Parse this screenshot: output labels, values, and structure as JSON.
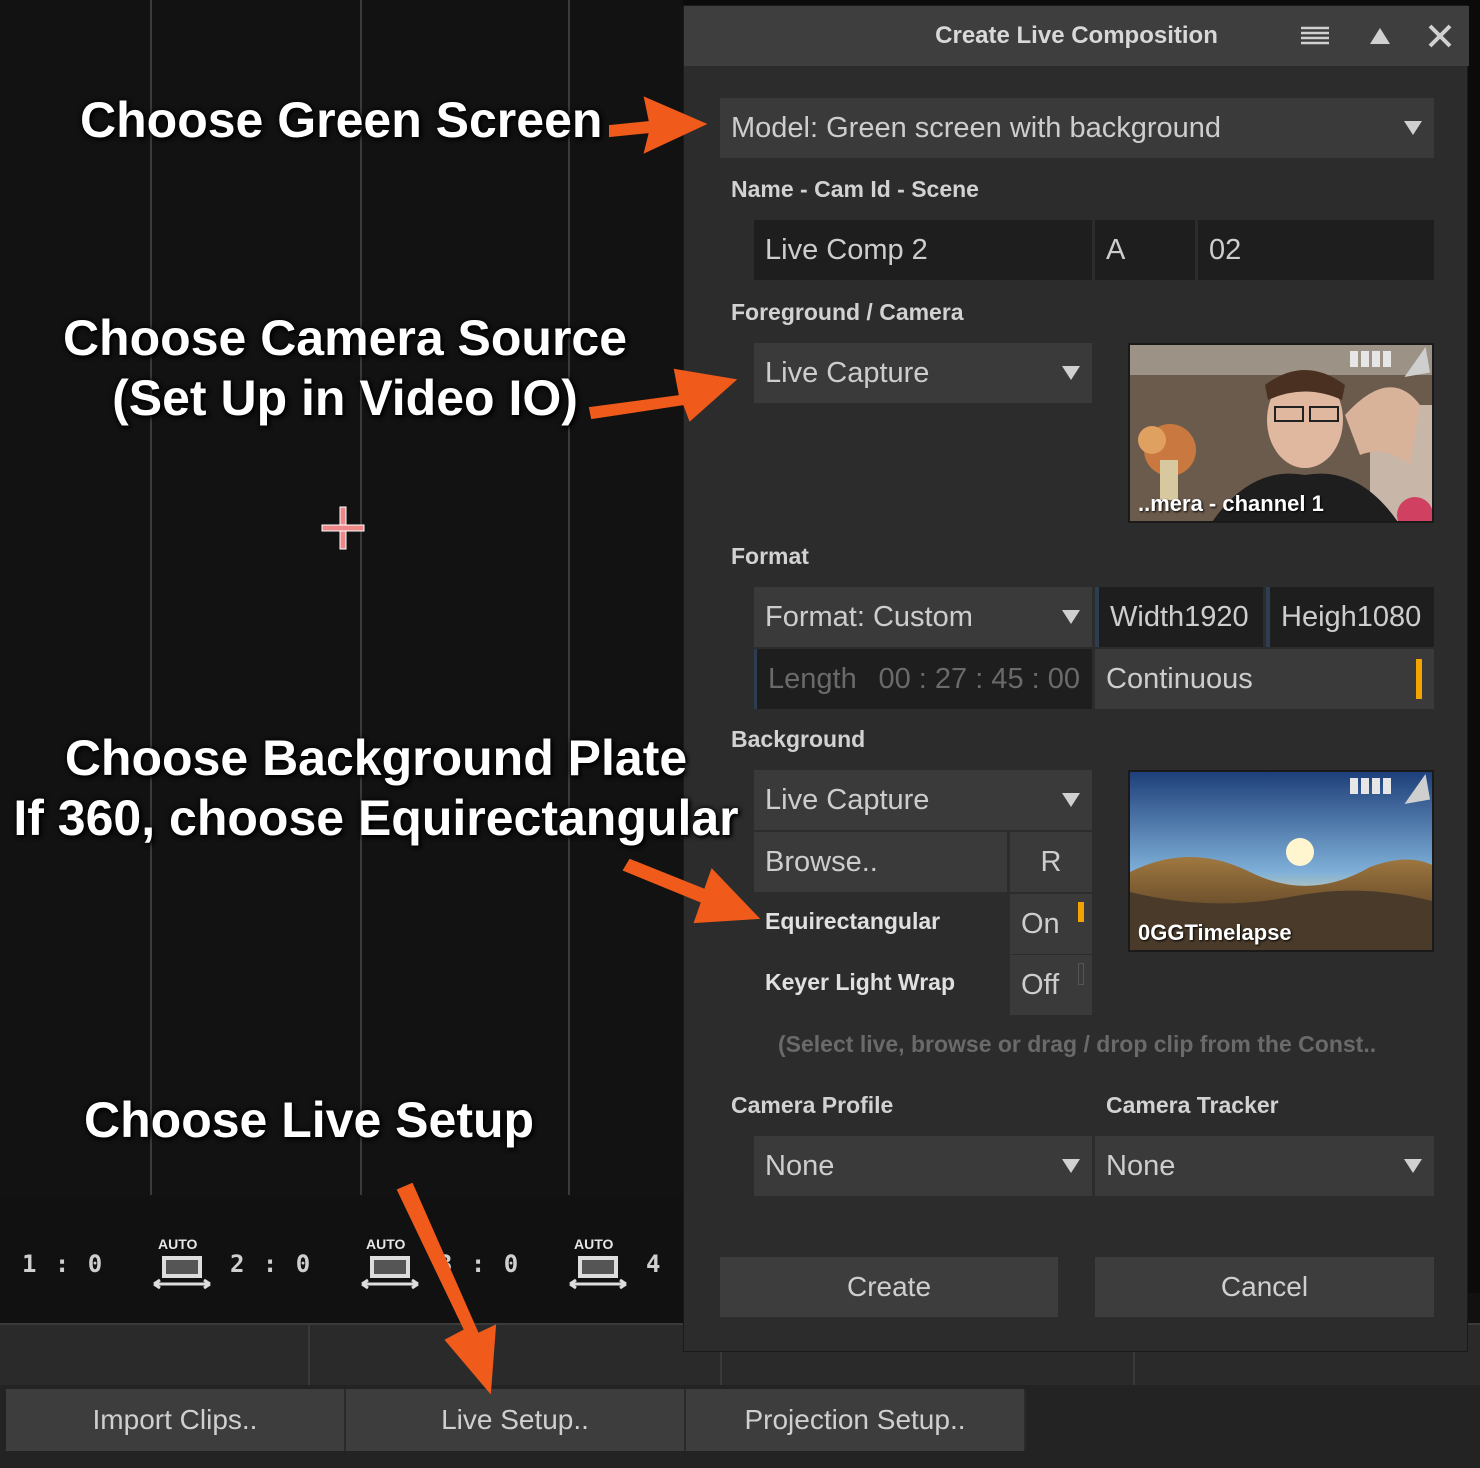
{
  "annotations": {
    "green_screen": "Choose Green Screen",
    "camera_line1": "Choose Camera Source",
    "camera_line2": "(Set Up in Video IO)",
    "background_line1": "Choose Background Plate",
    "background_line2": "If 360, choose Equirectangular",
    "live_setup": "Choose Live Setup",
    "arrow_color": "#f05a1a"
  },
  "timeline": {
    "markers": [
      "1 : 0",
      "2 : 0",
      "3 : 0",
      "4 :"
    ],
    "auto_label": "AUTO"
  },
  "bottom_buttons": {
    "import": "Import Clips..",
    "live_setup": "Live Setup..",
    "projection": "Projection Setup.."
  },
  "dialog": {
    "title": "Create Live Composition",
    "icons": [
      "menu-icon",
      "collapse-icon",
      "close-icon"
    ],
    "model": "Model: Green screen with background",
    "name_label": "Name - Cam Id - Scene",
    "name": "Live Comp 2",
    "cam_id": "A",
    "scene": "02",
    "foreground_label": "Foreground / Camera",
    "foreground_source": "Live Capture",
    "foreground_thumb_caption": "..mera - channel 1",
    "format_label": "Format",
    "format": "Format: Custom",
    "width_label": "Width",
    "width": "1920",
    "height_label": "Heigh",
    "height": "1080",
    "length_label": "Length",
    "length": "00 : 27 : 45 : 00",
    "continuous": "Continuous",
    "background_label": "Background",
    "background_source": "Live Capture",
    "browse": "Browse..",
    "r_button": "R",
    "equirect_label": "Equirectangular",
    "equirect_value": "On",
    "lightwrap_label": "Keyer Light Wrap",
    "lightwrap_value": "Off",
    "background_thumb_caption": "0GGTimelapse",
    "hint": "(Select live, browse or drag / drop clip from the Const..",
    "camera_profile_label": "Camera Profile",
    "camera_profile": "None",
    "camera_tracker_label": "Camera Tracker",
    "camera_tracker": "None",
    "create": "Create",
    "cancel": "Cancel",
    "accent": "#f5a300"
  }
}
